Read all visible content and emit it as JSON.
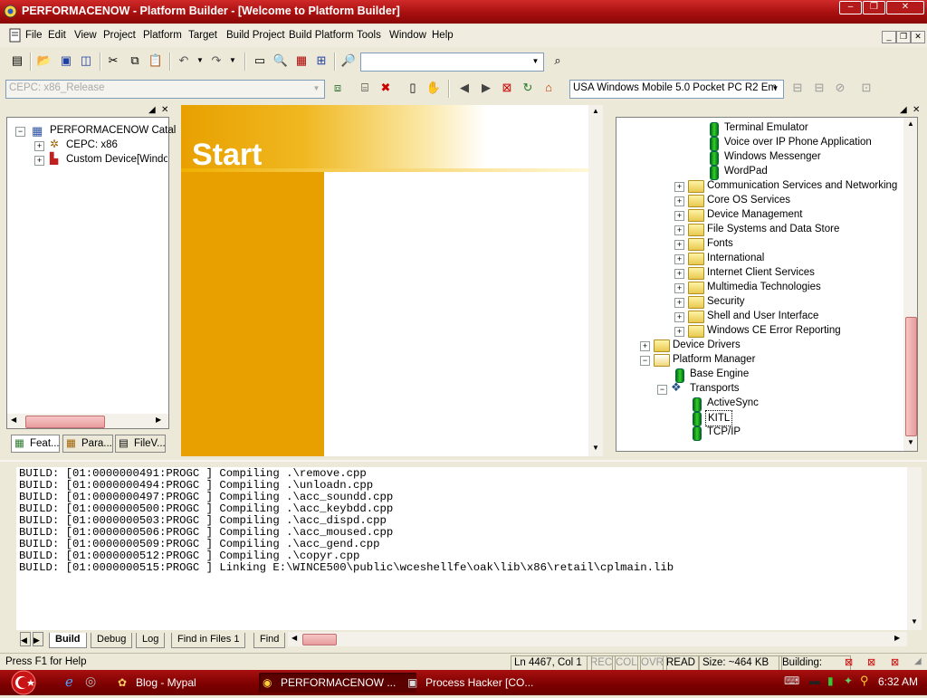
{
  "window": {
    "title": "PERFORMACENOW - Platform Builder - [Welcome to Platform Builder]"
  },
  "menu": [
    "File",
    "Edit",
    "View",
    "Project",
    "Platform",
    "Target",
    "Build Project",
    "Build Platform",
    "Tools",
    "Window",
    "Help"
  ],
  "toolbar2": {
    "config_combo": "CEPC: x86_Release",
    "sdk_combo": "USA Windows Mobile 5.0 Pocket PC R2 Em"
  },
  "left_tree": {
    "root": "PERFORMACENOW Catal",
    "items": [
      "CEPC: x86",
      "Custom Device[Windo"
    ],
    "tabs": [
      "Feat...",
      "Para...",
      "FileV..."
    ]
  },
  "start_page": {
    "heading": "Start"
  },
  "catalog": {
    "components_top": [
      "Terminal Emulator",
      "Voice over IP Phone Application",
      "Windows Messenger",
      "WordPad"
    ],
    "folders": [
      "Communication Services and Networking",
      "Core OS Services",
      "Device Management",
      "File Systems and Data Store",
      "Fonts",
      "International",
      "Internet Client Services",
      "Multimedia Technologies",
      "Security",
      "Shell and User Interface",
      "Windows CE Error Reporting"
    ],
    "device_drivers": "Device Drivers",
    "platform_manager": "Platform Manager",
    "base_engine": "Base Engine",
    "transports": "Transports",
    "transport_items": [
      "ActiveSync",
      "KITL",
      "TCP/IP"
    ]
  },
  "output": {
    "lines": [
      "BUILD: [01:0000000491:PROGC ] Compiling .\\remove.cpp",
      "BUILD: [01:0000000494:PROGC ] Compiling .\\unloadn.cpp",
      "BUILD: [01:0000000497:PROGC ] Compiling .\\acc_soundd.cpp",
      "BUILD: [01:0000000500:PROGC ] Compiling .\\acc_keybdd.cpp",
      "BUILD: [01:0000000503:PROGC ] Compiling .\\acc_dispd.cpp",
      "BUILD: [01:0000000506:PROGC ] Compiling .\\acc_moused.cpp",
      "BUILD: [01:0000000509:PROGC ] Compiling .\\acc_gend.cpp",
      "BUILD: [01:0000000512:PROGC ] Compiling .\\copyr.cpp",
      "BUILD: [01:0000000515:PROGC ] Linking E:\\WINCE500\\public\\wceshellfe\\oak\\lib\\x86\\retail\\cplmain.lib"
    ],
    "tabs": [
      "Build",
      "Debug",
      "Log",
      "Find in Files 1",
      "Find"
    ]
  },
  "status": {
    "help": "Press F1 for Help",
    "position": "Ln 4467, Col 1",
    "rec": "REC",
    "col": "COL",
    "ovr": "OVR",
    "read": "READ",
    "size": "Size: ~464 KB",
    "building": "Building:"
  },
  "taskbar": {
    "tasks": [
      "Blog - Mypal",
      "PERFORMACENOW ...",
      "Process Hacker [CO..."
    ],
    "clock": "6:32 AM"
  },
  "colors": {
    "titlebar": "#b41a1a",
    "start_orange": "#e8a000",
    "taskbar": "#8a0000"
  }
}
